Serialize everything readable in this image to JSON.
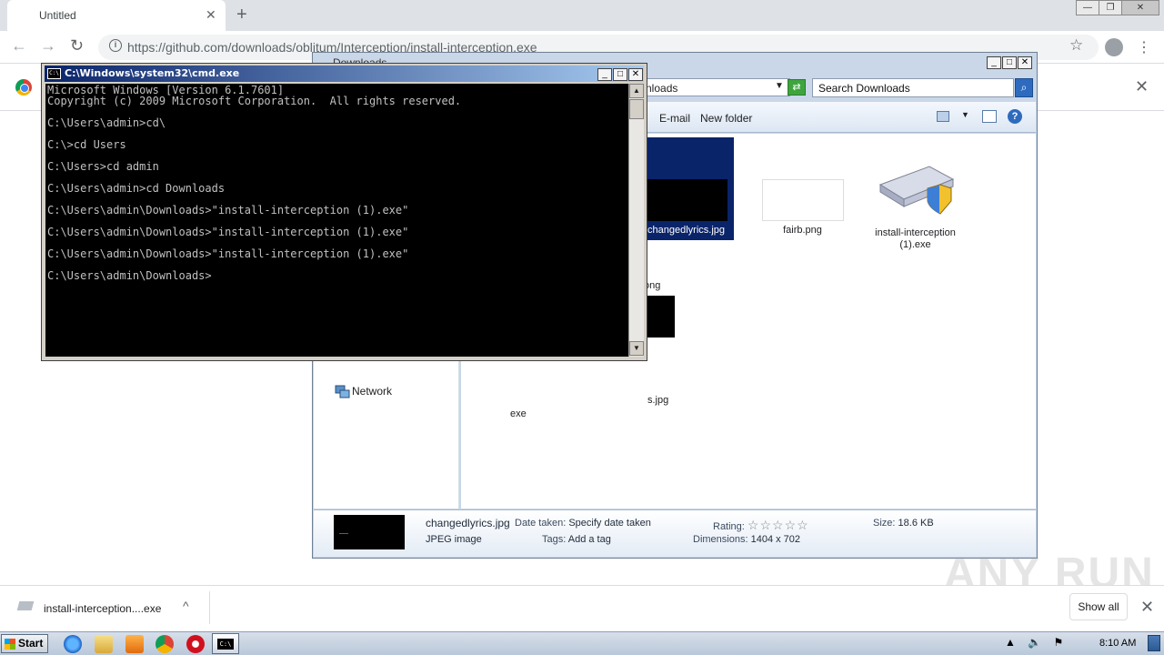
{
  "browser": {
    "tab_title": "Untitled",
    "tab_close": "✕",
    "new_tab": "+",
    "url": "https://github.com/downloads/oblitum/Interception/install-interception.exe",
    "window_buttons": [
      "—",
      "❐",
      "✕"
    ]
  },
  "explorer": {
    "title": "Downloads",
    "address": "nloads",
    "search_placeholder": "Search Downloads",
    "toolbar": {
      "email": "E-mail",
      "new_folder": "New folder"
    },
    "nav": {
      "network": "Network"
    },
    "files": [
      {
        "name": "ong",
        "thumb": "png"
      },
      {
        "name": "changedlyrics.jpg",
        "thumb": "black",
        "selected": true
      },
      {
        "name": "fairb.png",
        "thumb": "white"
      },
      {
        "name": "install-interception (1).exe",
        "thumb": "keyboard-shield"
      },
      {
        "name": "s.jpg",
        "thumb": "black"
      },
      {
        "name": "exe",
        "thumb": "none"
      }
    ],
    "details": {
      "filename": "changedlyrics.jpg",
      "filetype": "JPEG image",
      "date_taken_key": "Date taken:",
      "date_taken_val": "Specify date taken",
      "tags_key": "Tags:",
      "tags_val": "Add a tag",
      "rating_key": "Rating:",
      "rating_stars": "☆☆☆☆☆",
      "dimensions_key": "Dimensions:",
      "dimensions_val": "1404 x 702",
      "size_key": "Size:",
      "size_val": "18.6 KB"
    }
  },
  "cmd": {
    "title": "C:\\Windows\\system32\\cmd.exe",
    "lines": [
      "Microsoft Windows [Version 6.1.7601]",
      "Copyright (c) 2009 Microsoft Corporation.  All rights reserved.",
      "",
      "C:\\Users\\admin>cd\\",
      "",
      "C:\\>cd Users",
      "",
      "C:\\Users>cd admin",
      "",
      "C:\\Users\\admin>cd Downloads",
      "",
      "C:\\Users\\admin\\Downloads>\"install-interception (1).exe\"",
      "",
      "C:\\Users\\admin\\Downloads>\"install-interception (1).exe\"",
      "",
      "C:\\Users\\admin\\Downloads>\"install-interception (1).exe\"",
      "",
      "C:\\Users\\admin\\Downloads>"
    ]
  },
  "downloads_shelf": {
    "item_name": "install-interception....exe",
    "show_all": "Show all",
    "chevron": "^",
    "close": "✕"
  },
  "watermark": "ANY RUN",
  "taskbar": {
    "start_label": "Start",
    "clock": "8:10 AM",
    "tray_icons": [
      "▲",
      "🔈",
      "⚑"
    ]
  }
}
